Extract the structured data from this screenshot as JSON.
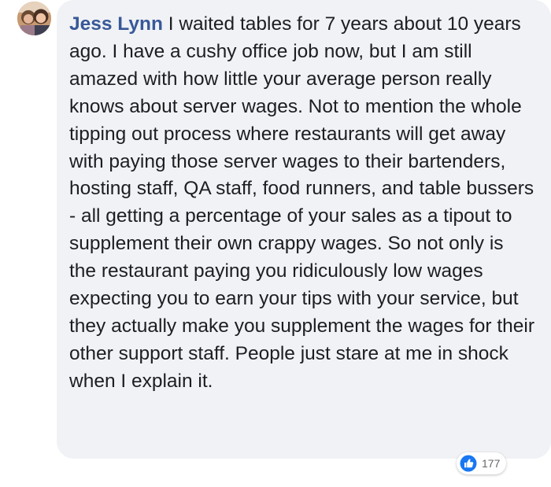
{
  "comment": {
    "author": "Jess Lynn",
    "text": "I waited tables for 7 years about 10 years ago. I have a cushy office job now, but I am still amazed with how little your average person really knows about server wages. Not to mention the whole tipping out process where restaurants will get away with paying those server wages to their bartenders, hosting staff, QA staff, food runners, and table bussers - all getting a percentage of your sales as a tipout to supplement their own crappy wages. So not only is the restaurant paying you ridiculously low wages expecting you to earn your tips with your service, but they actually make you supplement the wages for their other support staff. People just stare at me in shock when I explain it.",
    "reaction_icon": "like-icon",
    "reaction_count": "177"
  },
  "colors": {
    "author": "#385898",
    "bubble": "#f0f2f5",
    "text": "#1c1e21",
    "like": "#1877f2"
  }
}
